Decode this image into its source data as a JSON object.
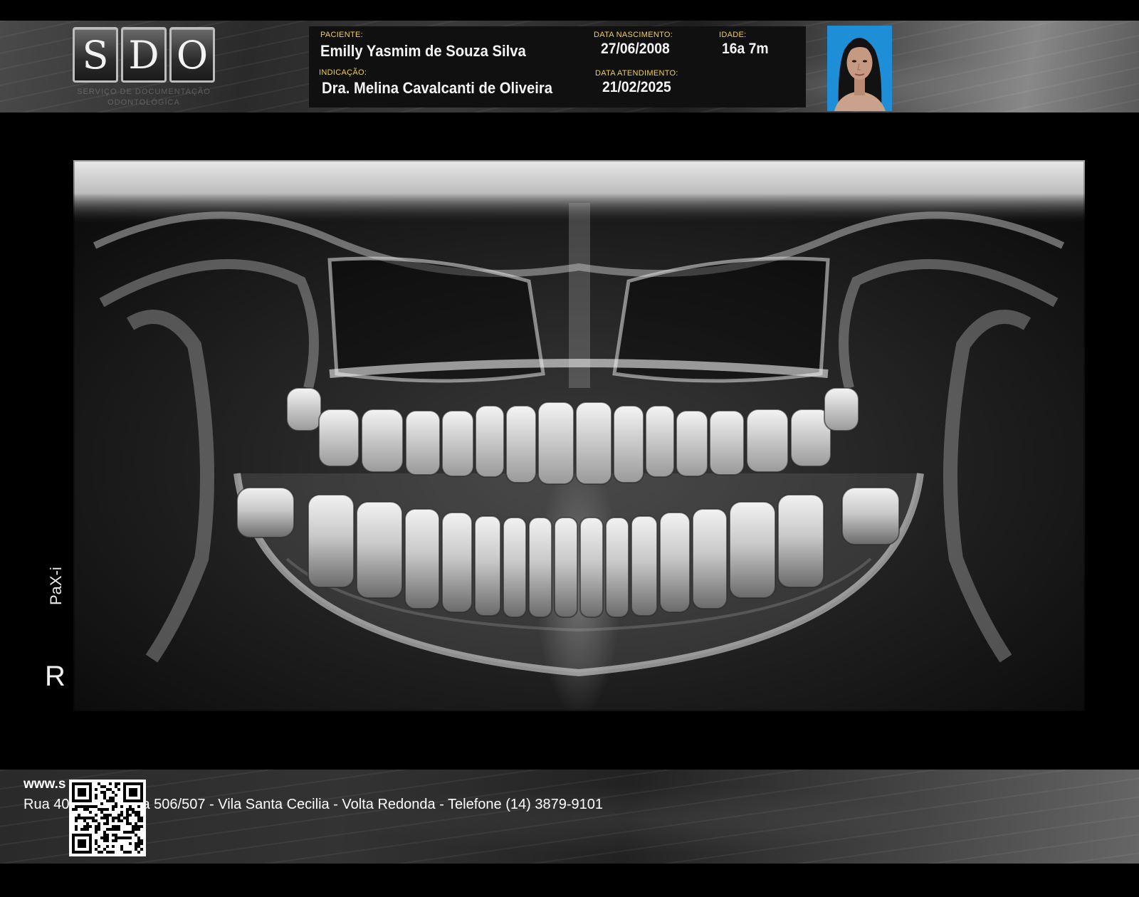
{
  "brand": {
    "letters": [
      "S",
      "D",
      "O"
    ],
    "subtitle_line1": "SERVIÇO DE DOCUMENTAÇÃO",
    "subtitle_line2": "ODONTOLÓGICA"
  },
  "patient": {
    "name_label": "PACIENTE:",
    "name": "Emilly Yasmim de Souza Silva",
    "birth_label": "DATA NASCIMENTO:",
    "birth_date": "27/06/2008",
    "age_label": "IDADE:",
    "age": "16a 7m",
    "referral_label": "INDICAÇÃO:",
    "referral": "Dra. Melina Cavalcanti de Oliveira",
    "visit_label": "DATA ATENDIMENTO:",
    "visit_date": "21/02/2025"
  },
  "image": {
    "device_label": "PaX-i",
    "side_marker": "R"
  },
  "footer": {
    "website": "www.s",
    "address_prefix": "Rua 40",
    "address_rest": "a 506/507 - Vila Santa Cecilia - Volta Redonda  -  Telefone (14) 3879-9101"
  },
  "colors": {
    "label_yellow": "#f0d24a",
    "photo_background": "#1e8fd6",
    "background": "#000000"
  }
}
